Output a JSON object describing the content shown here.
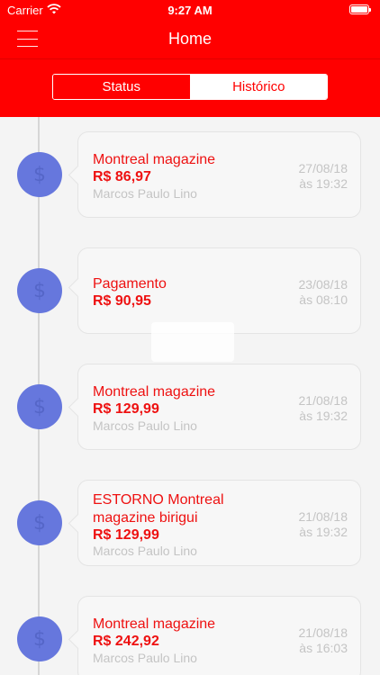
{
  "status_bar": {
    "carrier": "Carrier",
    "time": "9:27 AM"
  },
  "header": {
    "title": "Home",
    "accent_color": "#ff0000"
  },
  "tabs": [
    {
      "label": "Status",
      "selected": false
    },
    {
      "label": "Histórico",
      "selected": true
    }
  ],
  "icons": {
    "menu": "hamburger-menu-icon",
    "transaction": "dollar-icon",
    "dot_color": "#6677dd"
  },
  "transactions": [
    {
      "title": "Montreal magazine",
      "amount": "R$ 86,97",
      "name": "Marcos Paulo Lino",
      "date": "27/08/18",
      "time": "às 19:32"
    },
    {
      "title": "Pagamento",
      "amount": "R$ 90,95",
      "name": "",
      "date": "23/08/18",
      "time": "às 08:10"
    },
    {
      "title": "Montreal magazine",
      "amount": "R$ 129,99",
      "name": "Marcos Paulo Lino",
      "date": "21/08/18",
      "time": "às 19:32"
    },
    {
      "title": "ESTORNO Montreal magazine birigui",
      "amount": "R$ 129,99",
      "name": "Marcos Paulo Lino",
      "date": "21/08/18",
      "time": "às 19:32"
    },
    {
      "title": "Montreal magazine",
      "amount": "R$ 242,92",
      "name": "Marcos Paulo Lino",
      "date": "21/08/18",
      "time": "às 16:03"
    }
  ]
}
